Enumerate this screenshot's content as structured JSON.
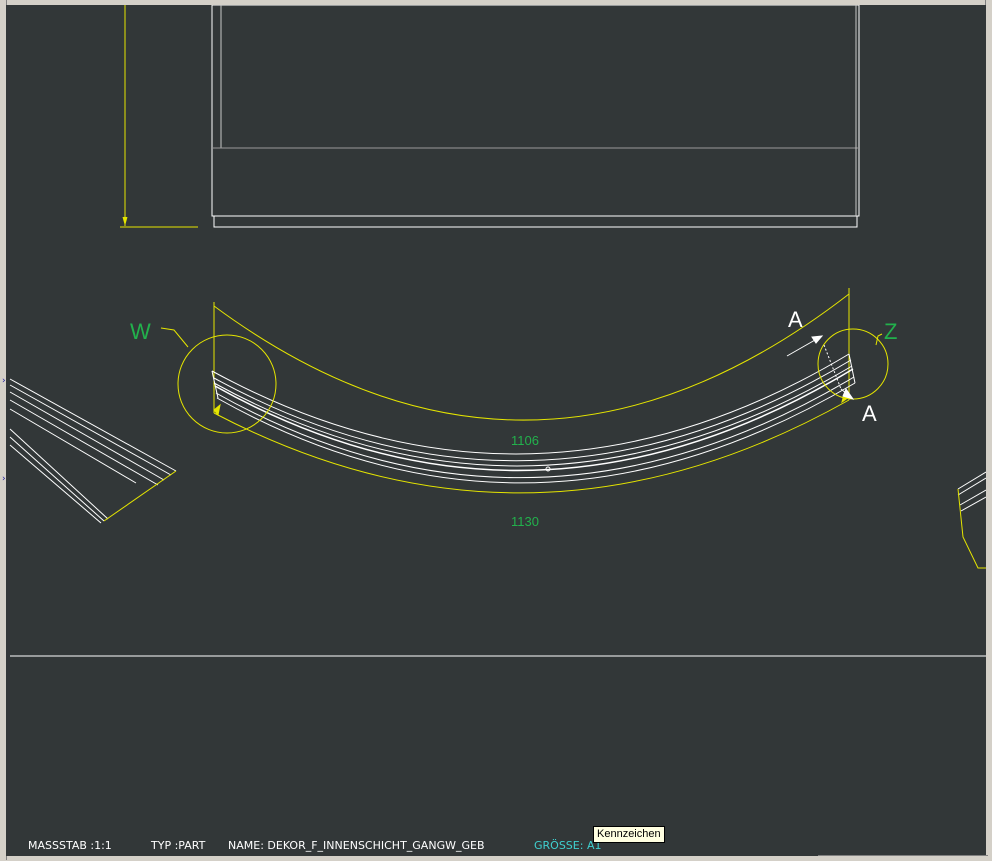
{
  "drawing": {
    "detail_labels": {
      "left": "W",
      "right": "Z"
    },
    "section_labels": {
      "top": "A",
      "bottom": "A"
    },
    "dimensions": {
      "inner_arc": "1106",
      "outer_arc": "1130"
    },
    "colors": {
      "background": "#323738",
      "geometry": "#ffffff",
      "dimension_lines": "#e5e500",
      "dimension_text": "#22b14c",
      "size_label": "#3fd0d0"
    }
  },
  "title_block": {
    "scale": "MASSSTAB :1:1",
    "type": "TYP :PART",
    "name": "NAME: DEKOR_F_INNENSCHICHT_GANGW_GEB",
    "size": "GRÖSSE: A1"
  },
  "tooltip": {
    "text": "Kennzeichen"
  },
  "icons": {
    "splitter": "chevron-right-icon"
  }
}
